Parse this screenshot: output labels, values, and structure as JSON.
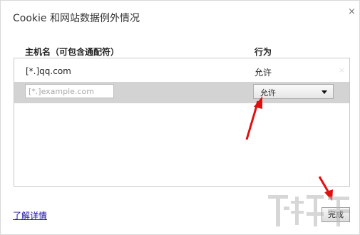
{
  "dialog": {
    "title": "Cookie 和网站数据例外情况",
    "close_glyph": "×"
  },
  "table": {
    "col_host": "主机名（可包含通配符）",
    "col_action": "行为",
    "rows": [
      {
        "host": "[*.]qq.com",
        "action": "允许",
        "remove_glyph": "×"
      }
    ],
    "new_row": {
      "host_placeholder": "[*.]example.com",
      "host_value": "",
      "action_selected": "允许"
    }
  },
  "footer": {
    "learn_more": "了解详情",
    "done_label": "完成"
  },
  "annotation": {
    "arrow_color": "#e01010"
  }
}
